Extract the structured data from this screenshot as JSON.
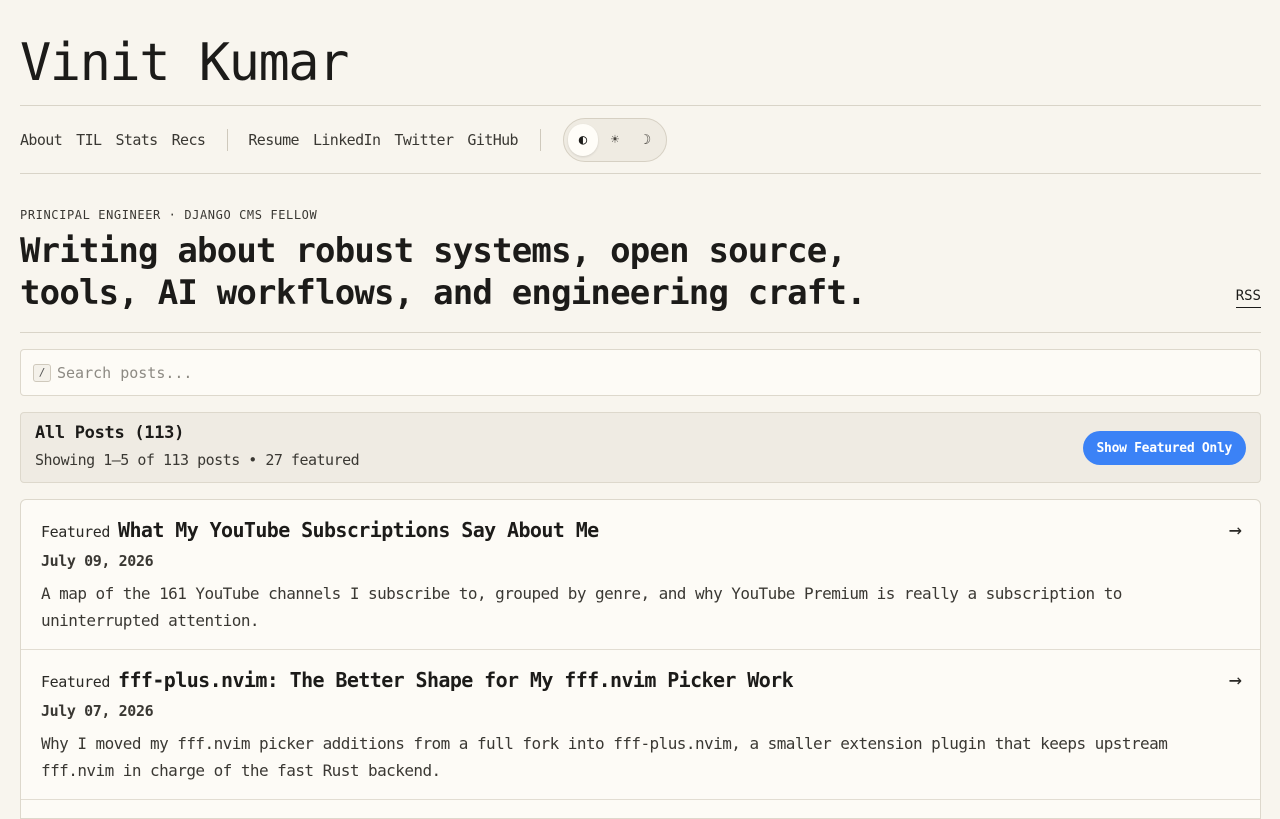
{
  "site": {
    "title": "Vinit Kumar"
  },
  "nav": {
    "primary": [
      "About",
      "TIL",
      "Stats",
      "Recs"
    ],
    "secondary": [
      "Resume",
      "LinkedIn",
      "Twitter",
      "GitHub"
    ],
    "theme": {
      "auto": "◐",
      "light": "☀",
      "dark": "☽",
      "active": "auto"
    }
  },
  "hero": {
    "eyebrow": "PRINCIPAL ENGINEER · DJANGO CMS FELLOW",
    "headline": "Writing about robust systems, open source, tools, AI workflows, and engineering craft.",
    "rss": "RSS"
  },
  "search": {
    "key_hint": "/",
    "placeholder": "Search posts...",
    "value": ""
  },
  "filter": {
    "title": "All Posts (113)",
    "subtitle": "Showing 1–5 of 113 posts • 27 featured",
    "button": "Show Featured Only"
  },
  "posts": [
    {
      "badge": "Featured",
      "title": "What My YouTube Subscriptions Say About Me",
      "date": "July 09, 2026",
      "excerpt": "A map of the 161 YouTube channels I subscribe to, grouped by genre, and why YouTube Premium is really a subscription to uninterrupted attention.",
      "arrow": "→"
    },
    {
      "badge": "Featured",
      "title": "fff-plus.nvim: The Better Shape for My fff.nvim Picker Work",
      "date": "July 07, 2026",
      "excerpt": "Why I moved my fff.nvim picker additions from a full fork into fff-plus.nvim, a smaller extension plugin that keeps upstream fff.nvim in charge of the fast Rust backend.",
      "arrow": "→"
    }
  ],
  "colors": {
    "background": "#f8f5ee",
    "accent": "#3b82f6",
    "text": "#1c1b19"
  }
}
